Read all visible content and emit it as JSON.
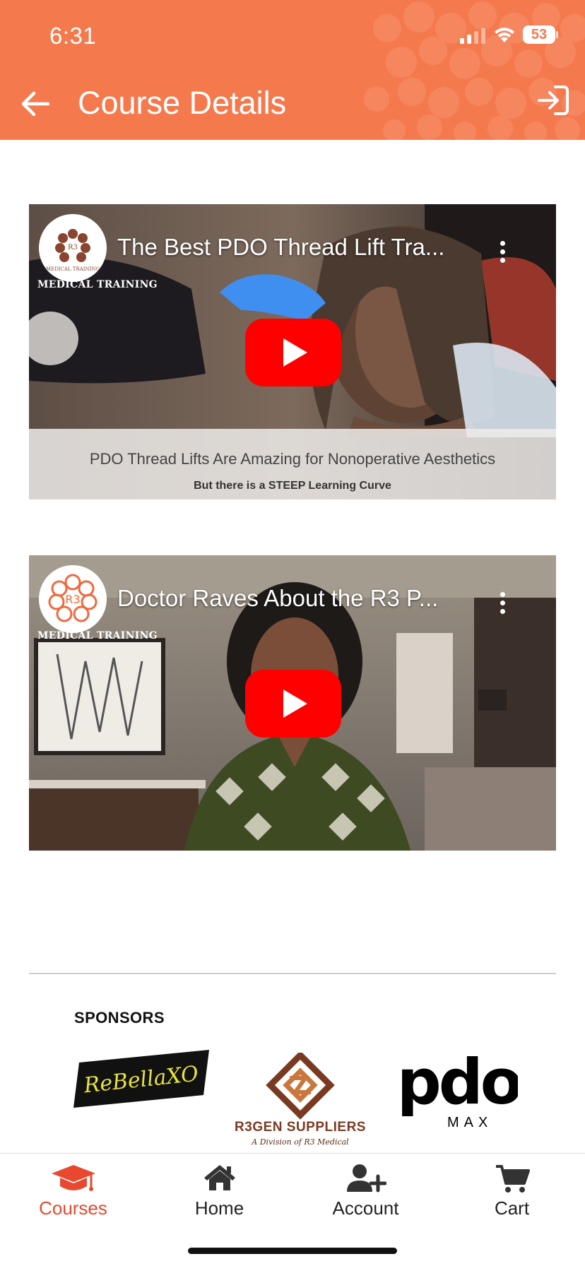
{
  "status_bar": {
    "time": "6:31",
    "battery": "53"
  },
  "header": {
    "title": "Course Details",
    "background": "#f47a4e"
  },
  "videos": [
    {
      "title": "The Best PDO Thread Lift Tra...",
      "channel_caption": "MEDICAL TRAINING",
      "avatar_text": "MEDICAL TRAINING",
      "caption_main": "PDO Thread Lifts Are Amazing for Nonoperative Aesthetics",
      "caption_sub": "But there is a STEEP Learning Curve"
    },
    {
      "title": "Doctor Raves About the R3 P...",
      "channel_caption": "MEDICAL TRAINING",
      "avatar_text": "R3"
    }
  ],
  "sponsors": {
    "heading": "SPONSORS",
    "items": [
      {
        "name": "ReBellaXO"
      },
      {
        "name": "R3GEN SUPPLIERS",
        "subtitle": "A Division of R3 Medical"
      },
      {
        "name": "pdo",
        "subtitle": "MAX"
      }
    ]
  },
  "tabs": [
    {
      "label": "Courses",
      "icon": "graduation-cap-icon",
      "active": true
    },
    {
      "label": "Home",
      "icon": "home-icon",
      "active": false
    },
    {
      "label": "Account",
      "icon": "user-plus-icon",
      "active": false
    },
    {
      "label": "Cart",
      "icon": "cart-icon",
      "active": false
    }
  ],
  "colors": {
    "accent": "#e8482d",
    "youtube_red": "#ff0000"
  }
}
